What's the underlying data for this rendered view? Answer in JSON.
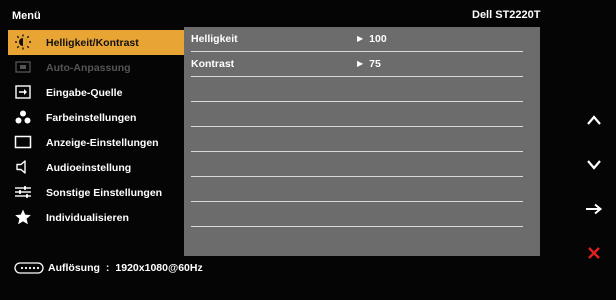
{
  "header": {
    "title": "Menü",
    "model": "Dell ST2220T"
  },
  "menu": {
    "items": [
      {
        "label": "Helligkeit/Kontrast",
        "icon": "sun-icon",
        "state": "selected"
      },
      {
        "label": "Auto-Anpassung",
        "icon": "auto-adjust-icon",
        "state": "disabled"
      },
      {
        "label": "Eingabe-Quelle",
        "icon": "input-source-icon",
        "state": "normal"
      },
      {
        "label": "Farbeinstellungen",
        "icon": "color-dots-icon",
        "state": "normal"
      },
      {
        "label": "Anzeige-Einstellungen",
        "icon": "display-icon",
        "state": "normal"
      },
      {
        "label": "Audioeinstellung",
        "icon": "speaker-icon",
        "state": "normal"
      },
      {
        "label": "Sonstige Einstellungen",
        "icon": "sliders-icon",
        "state": "normal"
      },
      {
        "label": "Individualisieren",
        "icon": "star-icon",
        "state": "normal"
      }
    ]
  },
  "settings": [
    {
      "name": "Helligkeit",
      "value": "100"
    },
    {
      "name": "Kontrast",
      "value": "75"
    }
  ],
  "status": {
    "label": "Auflösung",
    "separator": ":",
    "value": "1920x1080@60Hz"
  },
  "nav": {
    "up_icon": "chevron-up-icon",
    "down_icon": "chevron-down-icon",
    "enter_icon": "arrow-right-icon",
    "exit_icon": "close-icon"
  },
  "colors": {
    "highlight": "#e9a534",
    "panel": "#6c6c6c",
    "exit": "#e02020"
  }
}
